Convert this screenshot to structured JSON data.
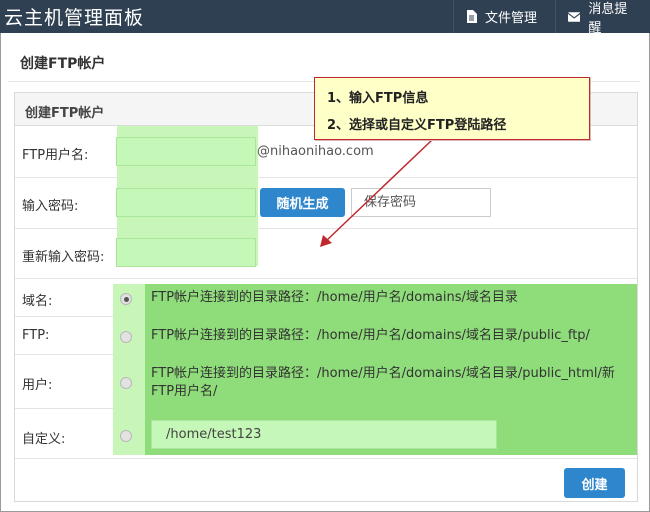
{
  "header": {
    "app_title": "云主机管理面板",
    "nav": [
      {
        "label": "文件管理",
        "icon": "document-icon"
      },
      {
        "label": "消息提醒",
        "icon": "envelope-icon"
      }
    ]
  },
  "page": {
    "title": "创建FTP帐户",
    "card_title": "创建FTP帐户"
  },
  "form": {
    "username_label": "FTP用户名:",
    "username_value": "",
    "domain_suffix": "@nihaonihao.com",
    "password_label": "输入密码:",
    "password_value": "",
    "random_button": "随机生成",
    "save_password": "保存密码",
    "confirm_label": "重新输入密码:",
    "confirm_value": "",
    "options": [
      {
        "label": "域名:",
        "text": "FTP帐户连接到的目录路径：/home/用户名/domains/域名目录",
        "checked": true
      },
      {
        "label": "FTP:",
        "text": "FTP帐户连接到的目录路径：/home/用户名/domains/域名目录/public_ftp/",
        "checked": false
      },
      {
        "label": "用户:",
        "text": "FTP帐户连接到的目录路径：/home/用户名/domains/域名目录/public_html/新FTP用户名/",
        "checked": false
      },
      {
        "label": "自定义:",
        "value": "/home/test123",
        "checked": false
      }
    ],
    "create_button": "创建"
  },
  "annotation": {
    "line1": "1、输入FTP信息",
    "line2": "2、选择或自定义FTP登陆路径",
    "border_color": "#c0282d",
    "fill_color": "#ffffc8"
  },
  "colors": {
    "topbar": "#2f4052",
    "primary_button": "#2e86cc",
    "highlight_green": "#8fdc7a",
    "light_green": "#c5f7b8"
  }
}
